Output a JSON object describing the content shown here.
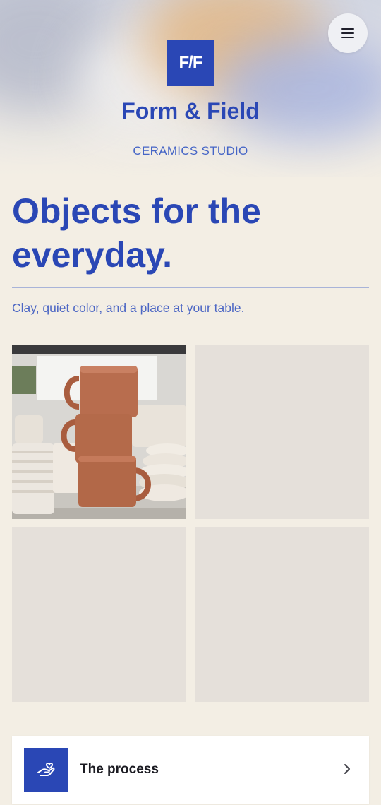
{
  "brand": {
    "logo_text": "F/F",
    "name": "Form & Field",
    "tagline": "CERAMICS STUDIO"
  },
  "header": {
    "menu_icon": "hamburger-menu-icon"
  },
  "hero": {
    "title": "Objects for the everyday.",
    "subtitle": "Clay, quiet color, and a place at your table."
  },
  "gallery": {
    "tiles": [
      {
        "kind": "photo",
        "subject": "stacked terracotta mugs"
      },
      {
        "kind": "placeholder"
      },
      {
        "kind": "placeholder"
      },
      {
        "kind": "placeholder"
      }
    ]
  },
  "cards": [
    {
      "label": "The process",
      "icon": "hand-holding-icon",
      "action_icon": "chevron-right-icon"
    }
  ],
  "colors": {
    "brand_blue": "#2a47b5",
    "background": "#f3eee4",
    "tile_placeholder": "#e5e0da",
    "terracotta": "#b86d4e"
  }
}
